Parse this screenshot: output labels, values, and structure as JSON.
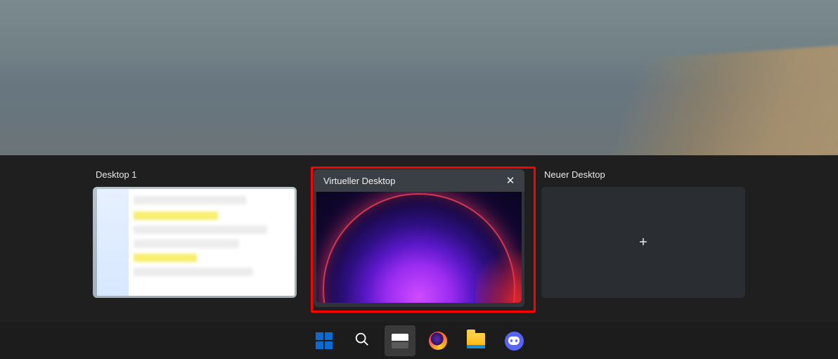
{
  "desktops": {
    "d1": {
      "label": "Desktop 1"
    },
    "d2": {
      "label": "Virtueller Desktop",
      "close_glyph": "✕"
    },
    "new": {
      "label": "Neuer Desktop",
      "plus_glyph": "+"
    }
  },
  "taskbar": {
    "items": [
      {
        "name": "start-button"
      },
      {
        "name": "search-button"
      },
      {
        "name": "task-view-button"
      },
      {
        "name": "firefox-app"
      },
      {
        "name": "file-explorer-app"
      },
      {
        "name": "discord-app"
      }
    ]
  },
  "annotation": {
    "selected_desktop": "d2",
    "highlight_color": "#ff0000"
  }
}
